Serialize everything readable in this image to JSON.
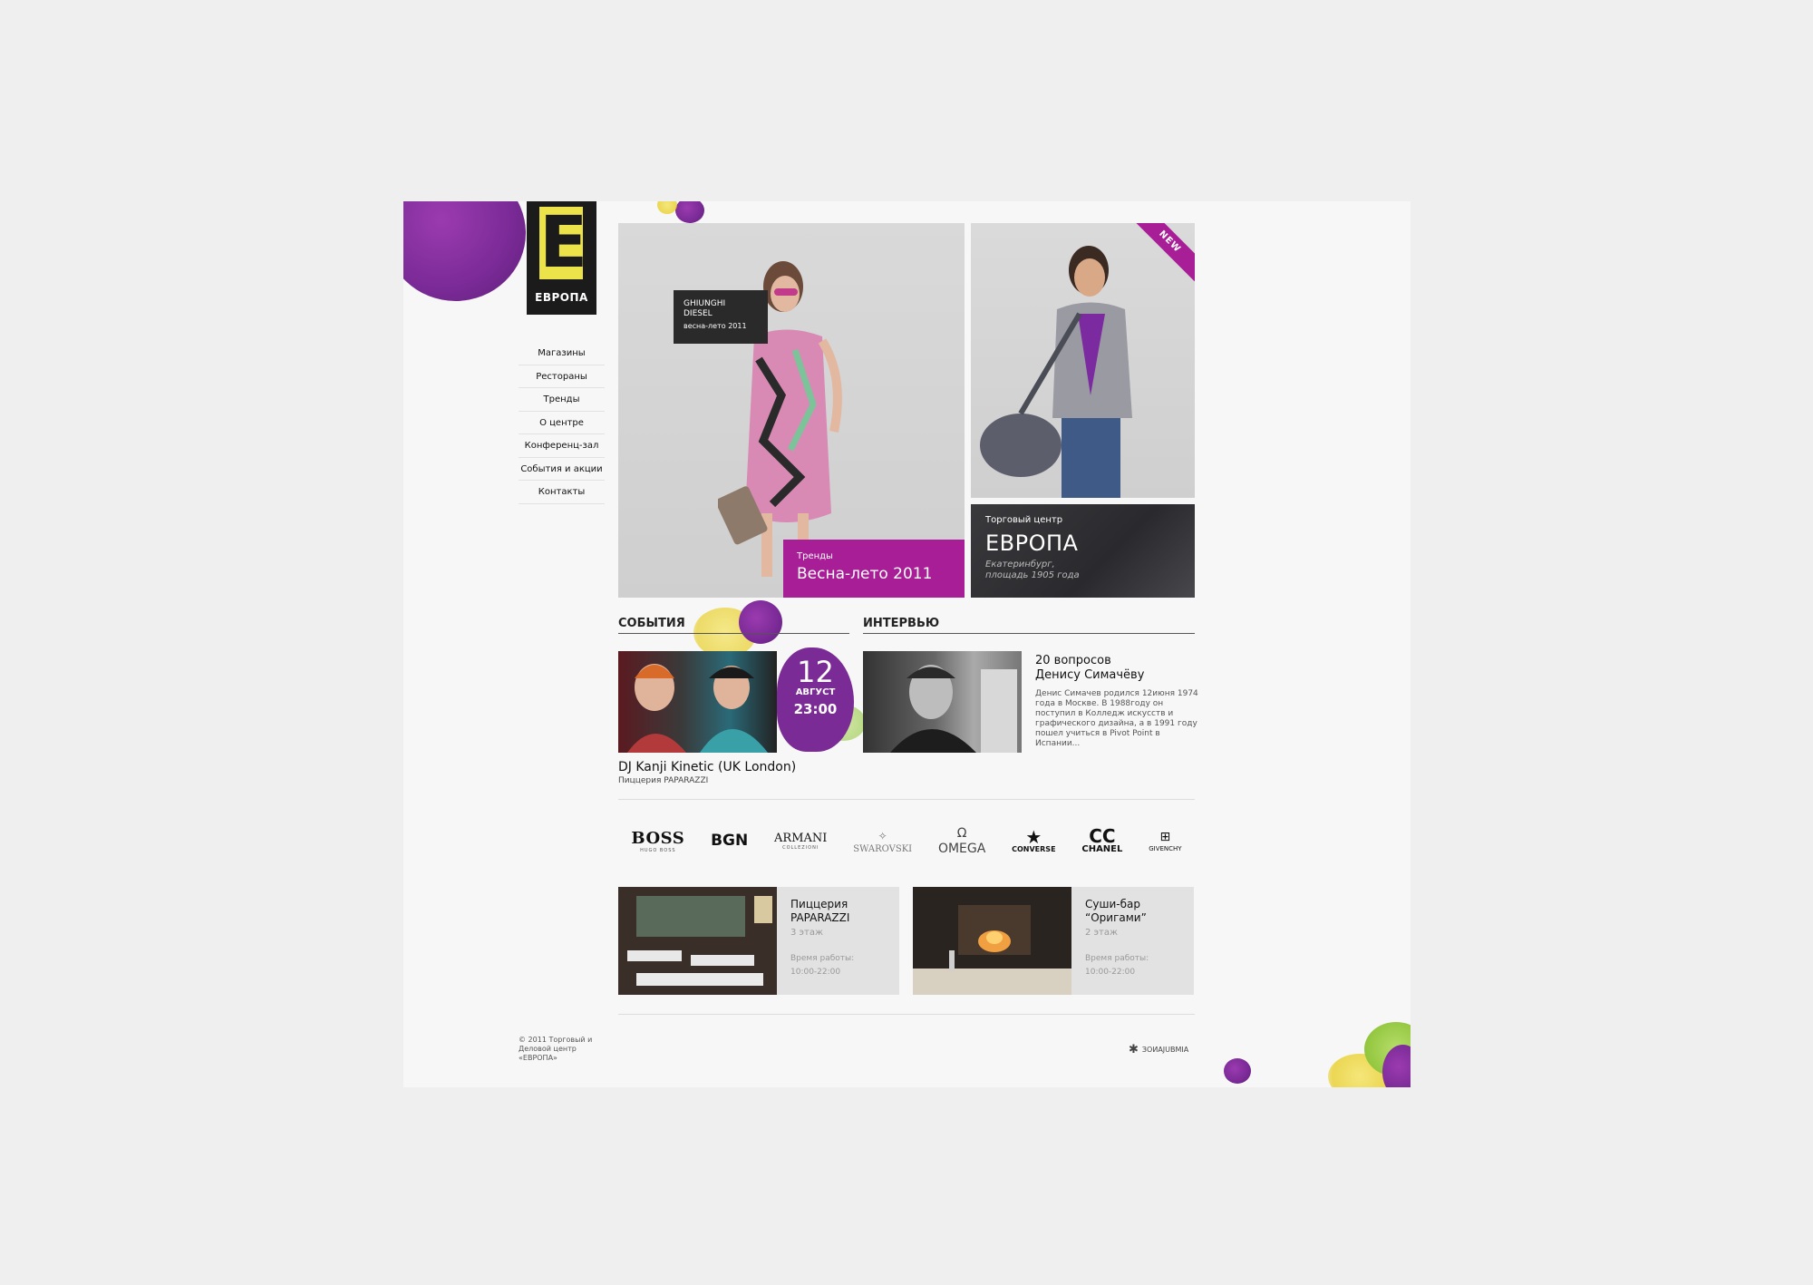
{
  "brand": {
    "logo_letter": "E",
    "logo_word": "ЕВРОПА"
  },
  "nav": [
    {
      "label": "Магазины"
    },
    {
      "label": "Рестораны"
    },
    {
      "label": "Тренды"
    },
    {
      "label": "О центре"
    },
    {
      "label": "Конференц-зал"
    },
    {
      "label": "События и акции"
    },
    {
      "label": "Контакты"
    }
  ],
  "hero": {
    "label_line1": "GHIUNGHI",
    "label_line2": "DIESEL",
    "label_line3": "весна-лето 2011",
    "caption_small": "Тренды",
    "caption_big": "Весна-лето 2011"
  },
  "promo": {
    "ribbon": "NEW"
  },
  "center": {
    "small": "Торговый центр",
    "name": "ЕВРОПА",
    "address_line1": "Екатеринбург,",
    "address_line2": "площадь 1905 года"
  },
  "events": {
    "heading": "СОБЫТИЯ",
    "day": "12",
    "month": "АВГУСТ",
    "time": "23:00",
    "title": "DJ Kanji Kinetic (UK London)",
    "venue": "Пиццерия PAPARAZZI"
  },
  "interview": {
    "heading": "ИНТЕРВЬЮ",
    "title_line1": "20 вопросов",
    "title_line2": "Денису Симачёву",
    "text": "Денис Симачев родился 12июня 1974 года в Москве. В 1988году он поступил в Колледж искусств и графического дизайна, а в 1991 году пошел учиться в Pivot Point в Испании..."
  },
  "brands": {
    "boss": "BOSS",
    "boss_sub": "HUGO BOSS",
    "bgn": "BGN",
    "armani": "ARMANI",
    "armani_sub": "COLLEZIONI",
    "swarovski": "SWAROVSKI",
    "omega": "OMEGA",
    "converse": "CONVERSE",
    "chanel": "CHANEL",
    "givenchy": "GIVENCHY"
  },
  "restaurants": [
    {
      "name_line1": "Пиццерия",
      "name_line2": "PAPARAZZI",
      "floor": "3 этаж",
      "hours_label": "Время работы:",
      "hours": "10:00-22:00"
    },
    {
      "name_line1": "Суши-бар",
      "name_line2": "“Оригами”",
      "floor": "2 этаж",
      "hours_label": "Время работы:",
      "hours": "10:00-22:00"
    }
  ],
  "footer": {
    "copyright": "© 2011 Торговый и Деловой центр «ЕВРОПА»",
    "credit": "ЗОИАЈUBMIA"
  },
  "colors": {
    "accent": "#a81e97",
    "blob_purple": "#7a2a96",
    "blob_yellow": "#e8cf2a",
    "blob_green": "#8fc43a",
    "dark": "#1b1b1b"
  }
}
